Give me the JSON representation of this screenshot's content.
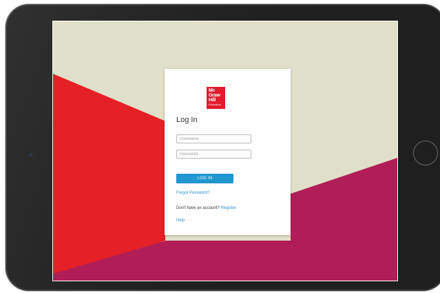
{
  "logo": {
    "lines": [
      "Mc",
      "Graw",
      "Hill"
    ],
    "subline": "Education",
    "color": "#e21b2d"
  },
  "login": {
    "title": "Log In",
    "username_placeholder": "Username",
    "password_placeholder": "Password",
    "submit_label": "LOG IN",
    "forgot_label": "Forgot Password?",
    "no_account_text": "Don't have an account?",
    "register_label": "Register",
    "help_label": "Help"
  },
  "colors": {
    "accent": "#2196d0",
    "link": "#2a8fc7",
    "background_beige": "#e0dfc9",
    "background_red": "#e62027",
    "background_magenta": "#b11e57",
    "device_frame": "#1f1f1f"
  }
}
